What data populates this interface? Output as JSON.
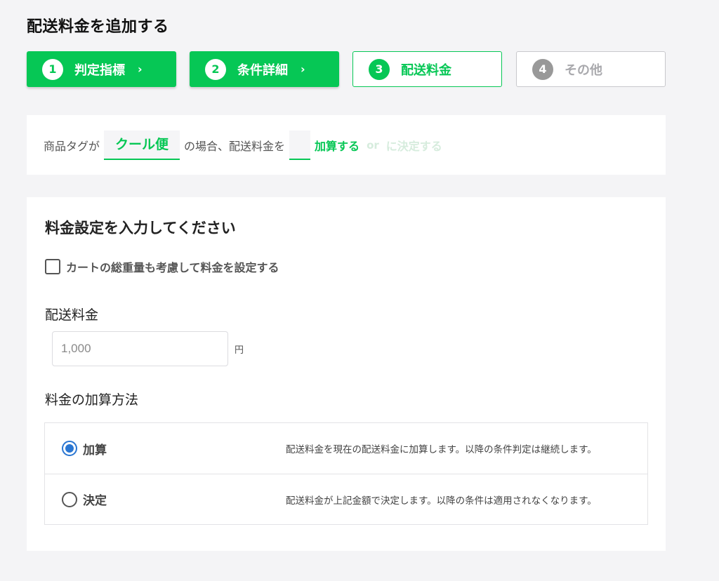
{
  "page_title": "配送料金を追加する",
  "steps": [
    {
      "number": "1",
      "label": "判定指標",
      "arrow": "›",
      "state": "done"
    },
    {
      "number": "2",
      "label": "条件詳細",
      "arrow": "›",
      "state": "done"
    },
    {
      "number": "3",
      "label": "配送料金",
      "state": "active"
    },
    {
      "number": "4",
      "label": "その他",
      "state": "future"
    }
  ],
  "condition": {
    "prefix": "商品タグが",
    "tag_value": "クール便",
    "middle": "の場合、配送料金を",
    "blank_value": "",
    "add_label": "加算する",
    "or_label": "or",
    "decide_label": "に決定する"
  },
  "settings": {
    "heading": "料金設定を入力してください",
    "checkbox_label": "カートの総重量も考慮して料金を設定する",
    "checkbox_checked": false,
    "fee_label": "配送料金",
    "fee_placeholder": "1,000",
    "fee_unit": "円",
    "method_label": "料金の加算方法",
    "options": [
      {
        "label": "加算",
        "description": "配送料金を現在の配送料金に加算します。以降の条件判定は継続します。",
        "selected": true
      },
      {
        "label": "決定",
        "description": "配送料金が上記金額で決定します。以降の条件は適用されなくなります。",
        "selected": false
      }
    ]
  },
  "colors": {
    "brand_green": "#06c755",
    "radio_blue": "#2a76d2",
    "background": "#f4f4f6"
  }
}
